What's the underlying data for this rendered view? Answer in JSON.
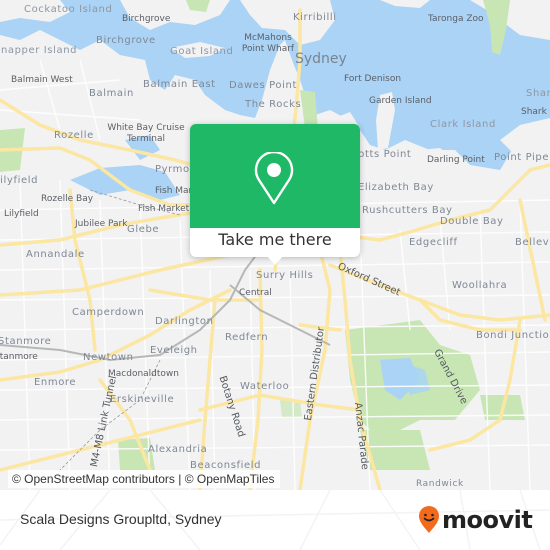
{
  "map": {
    "colors": {
      "water": "#aad3f5",
      "land": "#f2f2f3",
      "park": "#c8e6b4",
      "road_major": "#fbe6a2",
      "accent": "#1fb866",
      "logo_orange": "#f26b1d"
    },
    "labels": {
      "cockatoo_island": "Cockatoo Island",
      "birchgrove_small": "Birchgrove",
      "birchgrove": "Birchgrove",
      "snapper_island": "Snapper Island",
      "goat_island": "Goat Island",
      "mcmahons_point": "McMahons Point Wharf",
      "kirribilli": "Kirribilli",
      "taronga_zoo": "Taronga Zoo",
      "sydney": "Sydney",
      "balmain_west": "Balmain West",
      "balmain": "Balmain",
      "balmain_east": "Balmain East",
      "dawes_point": "Dawes Point",
      "fort_denison": "Fort Denison",
      "shark": "Shar",
      "shark_island": "Shark Is",
      "the_rocks": "The Rocks",
      "garden_island": "Garden Island",
      "rozelle": "Rozelle",
      "white_bay": "White Bay Cruise Terminal",
      "clark_island": "Clark Island",
      "potts_point": "Potts Point",
      "darling_point": "Darling Point",
      "point_piper": "Point Piper",
      "lilyfield_top": "Lilyfield",
      "pyrmont": "Pyrmont",
      "elizabeth_bay": "Elizabeth Bay",
      "rozelle_bay": "Rozelle Bay",
      "fish_market": "Fish Market",
      "lilyfield": "Lilyfield",
      "rushcutters_bay": "Rushcutters Bay",
      "fish_market_wharf": "Fish Market Wharf",
      "double_bay": "Double Bay",
      "jubilee_park": "Jubilee Park",
      "glebe": "Glebe",
      "edgecliff": "Edgecliff",
      "bellevue": "Bellevue",
      "annandale": "Annandale",
      "surry_hills": "Surry Hills",
      "oxford_street": "Oxford Street",
      "central": "Central",
      "woollahra": "Woollahra",
      "camperdown": "Camperdown",
      "darlington": "Darlington",
      "stanmore": "Stanmore",
      "stanmore_station": "Stanmore",
      "redfern": "Redfern",
      "bondi_junction": "Bondi Junction",
      "eveleigh": "Eveleigh",
      "newtown": "Newtown",
      "macdonaldtown": "Macdonaldtown",
      "grand_drive": "Grand Drive",
      "enmore": "Enmore",
      "eastern_distributor": "Eastern Distributor",
      "botany_road": "Botany Road",
      "waterloo": "Waterloo",
      "erskineville": "Erskineville",
      "m4_m8": "M4-M8 Link Tunnel",
      "anzac_parade": "Anzac Parade",
      "alexandria": "Alexandria",
      "beaconsfield": "Beaconsfield",
      "randwick": "Randwick"
    },
    "attribution": "© OpenStreetMap contributors | © OpenMapTiles"
  },
  "popup": {
    "icon": "map-pin-icon",
    "cta_label": "Take me there"
  },
  "footer": {
    "title": "Scala Designs Groupltd, Sydney",
    "logo_text": "moovit",
    "logo_icon": "moovit-smile-pin-icon"
  }
}
